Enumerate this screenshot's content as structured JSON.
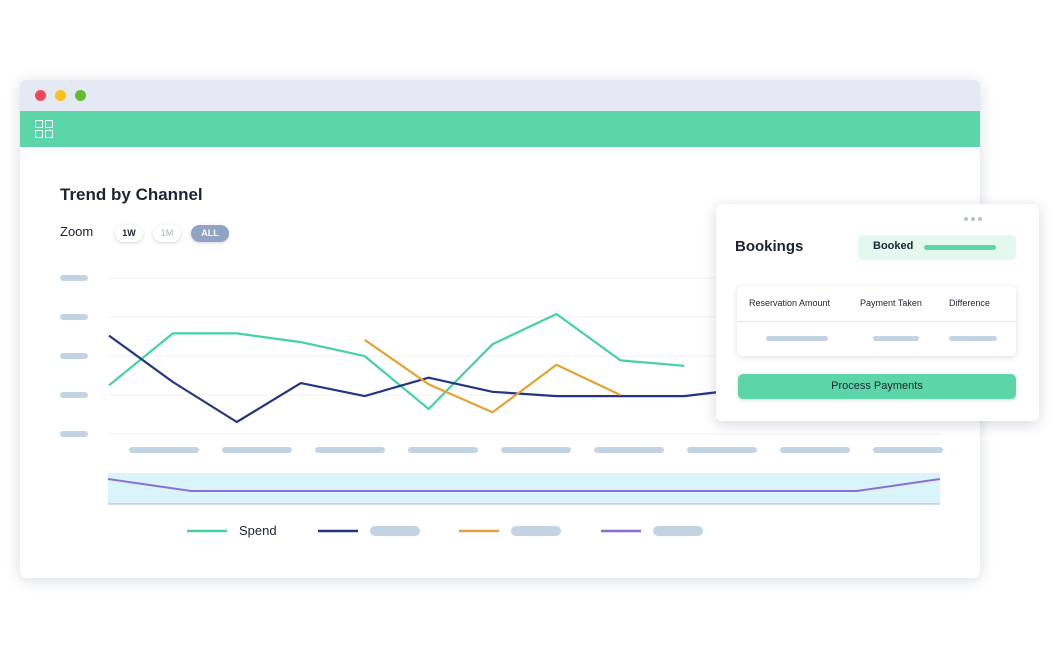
{
  "window": {
    "traffic_lights": {
      "close": "#ee4a5e",
      "minimize": "#f6c21a",
      "maximize": "#5fbd2f"
    },
    "appbar": {
      "color": "#5cd6a9",
      "icon": "grid-icon"
    }
  },
  "main": {
    "title": "Trend by Channel",
    "zoom_label": "Zoom",
    "zoom_options": [
      "1W",
      "1M",
      "ALL"
    ],
    "zoom_selected": "ALL"
  },
  "chart_data": {
    "type": "line",
    "title": "Trend by Channel",
    "y_tick_labels_obscured": true,
    "x_tick_labels_obscured": true,
    "x_points": 14,
    "grid": true,
    "legend_position": "bottom",
    "series": [
      {
        "name": "Spend",
        "color": "#43d3a0",
        "values": [
          0.34,
          0.82,
          0.82,
          0.74,
          0.61,
          0.12,
          0.72,
          1.0,
          0.57,
          0.52
        ]
      },
      {
        "color": "#23367f",
        "values": [
          0.8,
          0.37,
          0.0,
          0.36,
          0.24,
          0.41,
          0.28,
          0.24,
          0.24,
          0.24,
          0.31,
          0.81,
          0.42
        ]
      },
      {
        "color": "#e3a233",
        "values": [
          0.76,
          0.35,
          0.09,
          0.53,
          0.25
        ]
      },
      {
        "color": "#8c6fd0",
        "values": [
          1.0,
          0.0,
          0.0,
          0.0,
          0.0,
          0.0,
          0.0,
          0.0,
          0.0,
          0.0,
          1.0
        ]
      }
    ],
    "navigator": {
      "series_color": "#8c6fd0",
      "background": "#d9f4fb"
    }
  },
  "legend": {
    "items": [
      {
        "label": "Spend",
        "color": "#43d3a0"
      },
      {
        "label": "",
        "color": "#23367f"
      },
      {
        "label": "",
        "color": "#e3a233"
      },
      {
        "label": "",
        "color": "#8c6fd0"
      }
    ]
  },
  "bookings": {
    "title": "Bookings",
    "status_label": "Booked",
    "columns": [
      "Reservation Amount",
      "Payment Taken",
      "Difference"
    ],
    "action_label": "Process Payments",
    "more_icon": "more-dots-icon"
  }
}
